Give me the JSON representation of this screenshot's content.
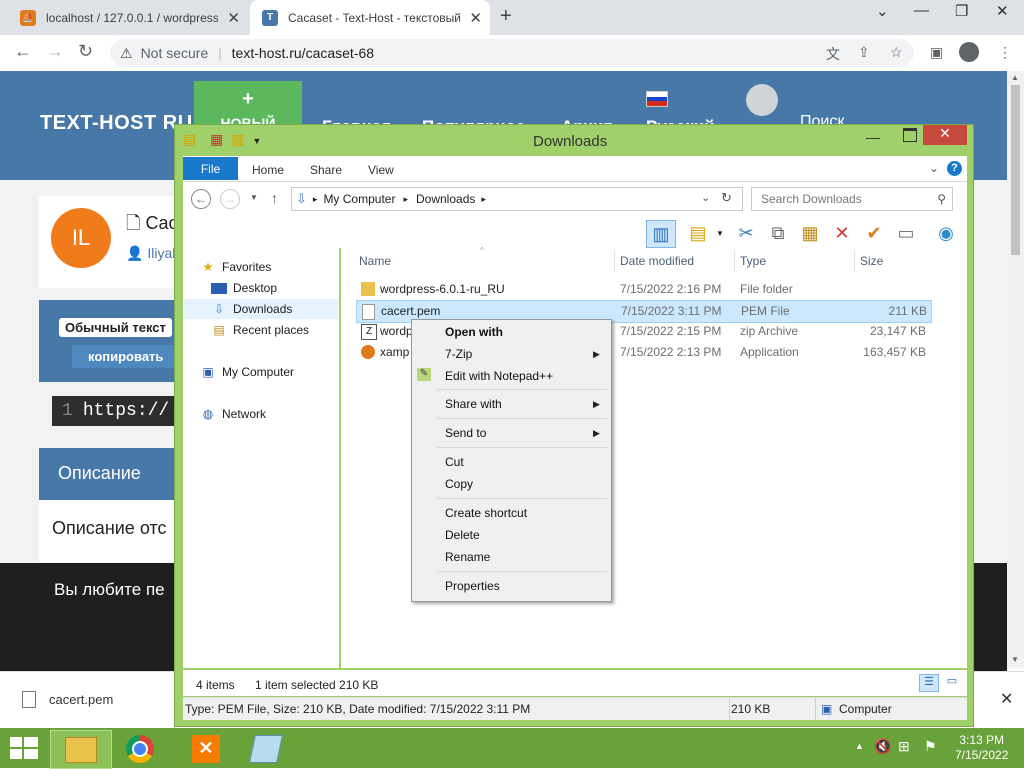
{
  "browser": {
    "tabs": [
      {
        "title": "localhost / 127.0.0.1 / wordpress"
      },
      {
        "title": "Cacaset - Text-Host - текстовый"
      }
    ],
    "address": {
      "security_label": "Not secure",
      "url": "text-host.ru/cacaset-68"
    }
  },
  "site": {
    "logo": "TEXT-HOST RU",
    "new_button": {
      "plus": "+",
      "label": "НОВЫЙ"
    },
    "nav": [
      "Главная",
      "Популярное",
      "Архив",
      "Русский"
    ],
    "search_label": "Поиск",
    "avatar_initials": "IL",
    "title_fragment": "Cac",
    "author_fragment": "Iliyab",
    "format_pill": "Обычный текст",
    "copy_label": "копировать",
    "code_line_number": "1",
    "code_fragment": "https://",
    "description_heading": "Описание",
    "description_text": "Описание отс",
    "dark_band_text": "Вы любите пе"
  },
  "download_bar": {
    "file": "cacert.pem"
  },
  "explorer": {
    "title": "Downloads",
    "ribbon_tabs": [
      "File",
      "Home",
      "Share",
      "View"
    ],
    "breadcrumb": [
      "My Computer",
      "Downloads"
    ],
    "search_placeholder": "Search Downloads",
    "nav_pane": {
      "favorites": "Favorites",
      "items": [
        "Desktop",
        "Downloads",
        "Recent places"
      ],
      "computer": "My Computer",
      "network": "Network"
    },
    "columns": [
      "Name",
      "Date modified",
      "Type",
      "Size"
    ],
    "files": [
      {
        "name": "wordpress-6.0.1-ru_RU",
        "date": "7/15/2022 2:16 PM",
        "type": "File folder",
        "size": ""
      },
      {
        "name": "cacert.pem",
        "date": "7/15/2022 3:11 PM",
        "type": "PEM File",
        "size": "211 KB"
      },
      {
        "name": "wordp",
        "date": "7/15/2022 2:15 PM",
        "type": "zip Archive",
        "size": "23,147 KB"
      },
      {
        "name": "xamp",
        "date": "7/15/2022 2:13 PM",
        "type": "Application",
        "size": "163,457 KB"
      }
    ],
    "status": {
      "items": "4 items",
      "selected": "1 item selected  210 KB"
    },
    "details": {
      "info": "Type: PEM File, Size: 210 KB, Date modified: 7/15/2022 3:11 PM",
      "size": "210 KB",
      "location": "Computer"
    }
  },
  "context_menu": {
    "open_with": "Open with",
    "seven_zip": "7-Zip",
    "notepad": "Edit with Notepad++",
    "share_with": "Share with",
    "send_to": "Send to",
    "cut": "Cut",
    "copy": "Copy",
    "create_shortcut": "Create shortcut",
    "delete": "Delete",
    "rename": "Rename",
    "properties": "Properties"
  },
  "taskbar": {
    "time": "3:13 PM",
    "date": "7/15/2022"
  },
  "colors": {
    "accent_blue": "#4778a8",
    "window_green": "#9fd06a",
    "taskbar_green": "#69a13a",
    "close_red": "#c7483c",
    "selection": "#cce8ff"
  }
}
